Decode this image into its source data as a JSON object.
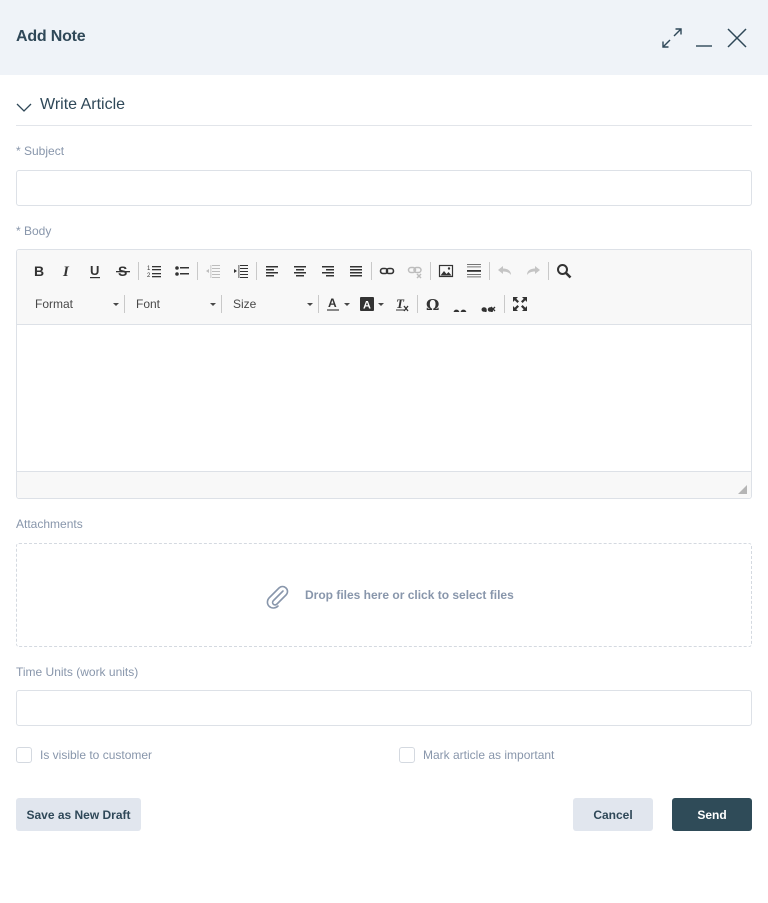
{
  "header": {
    "title": "Add Note",
    "actions": [
      {
        "name": "expand",
        "icon": "expand-icon"
      },
      {
        "name": "minimize",
        "icon": "minimize-icon"
      },
      {
        "name": "close",
        "icon": "close-icon"
      }
    ]
  },
  "section": {
    "title": "Write Article",
    "expanded": true,
    "icon": "chevron-down-icon"
  },
  "form": {
    "subject": {
      "label": "* Subject",
      "value": "",
      "placeholder": ""
    },
    "body": {
      "label": "* Body",
      "value": "",
      "toolbar": {
        "row1": [
          "Bold",
          "Italic",
          "Underline",
          "Strikethrough",
          "Insert/Remove Numbered List",
          "Insert/Remove Bulleted List",
          "Decrease Indent",
          "Increase Indent",
          "Align Left",
          "Center",
          "Align Right",
          "Justify",
          "Link",
          "Unlink",
          "Image",
          "Insert Horizontal Line",
          "Undo",
          "Redo",
          "Find"
        ],
        "row2": {
          "format": "Format",
          "font": "Font",
          "size": "Size",
          "buttons": [
            "Text Color",
            "Background Color",
            "Remove Format",
            "Insert Special Character",
            "Insert Code Quote",
            "Remove Quote",
            "Maximize"
          ]
        }
      }
    },
    "attachments": {
      "label": "Attachments",
      "dropzone_text": "Drop files here or click to select files",
      "icon": "paperclip-icon"
    },
    "time_units": {
      "label": "Time Units (work units)",
      "value": "",
      "placeholder": ""
    },
    "checkboxes": [
      {
        "label": "Is visible to customer",
        "checked": false
      },
      {
        "label": "Mark article as important",
        "checked": false
      }
    ]
  },
  "buttons": {
    "save_draft": "Save as New Draft",
    "cancel": "Cancel",
    "send": "Send"
  },
  "colors": {
    "header_bg": "#eff3f8",
    "primary": "#2f4b58",
    "secondary_button": "#e1e6ee",
    "muted_text": "#8896ab"
  }
}
